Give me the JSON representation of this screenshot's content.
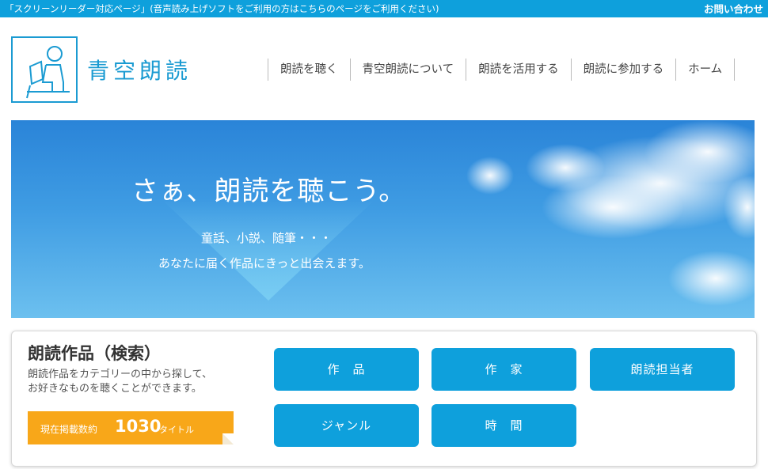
{
  "topbar": {
    "reader_link": "「スクリーンリーダー対応ページ」(音声読み上げソフトをご利用の方はこちらのページをご利用ください)",
    "contact": "お問い合わせ"
  },
  "logo": {
    "text": "青空朗読",
    "color": "#1b9bd2"
  },
  "nav": [
    {
      "label": "朗読を聴く"
    },
    {
      "label": "青空朗読について"
    },
    {
      "label": "朗読を活用する"
    },
    {
      "label": "朗読に参加する"
    },
    {
      "label": "ホーム"
    }
  ],
  "hero": {
    "headline": "さぁ、朗読を聴こう。",
    "sub1": "童話、小説、随筆・・・",
    "sub2": "あなたに届く作品にきっと出会えます。"
  },
  "search": {
    "title": "朗読作品（検索）",
    "desc_line1": "朗読作品をカテゴリーの中から探して、",
    "desc_line2": "お好きなものを聴くことができます。",
    "count_label": "現在掲載数約",
    "count_value": "1030",
    "count_unit": "タイトル",
    "buttons": [
      {
        "label": "作　品"
      },
      {
        "label": "作　家"
      },
      {
        "label": "朗読担当者"
      },
      {
        "label": "ジャンル"
      },
      {
        "label": "時　間"
      }
    ]
  },
  "colors": {
    "accent": "#0ea0dc",
    "badge": "#f8a719"
  }
}
